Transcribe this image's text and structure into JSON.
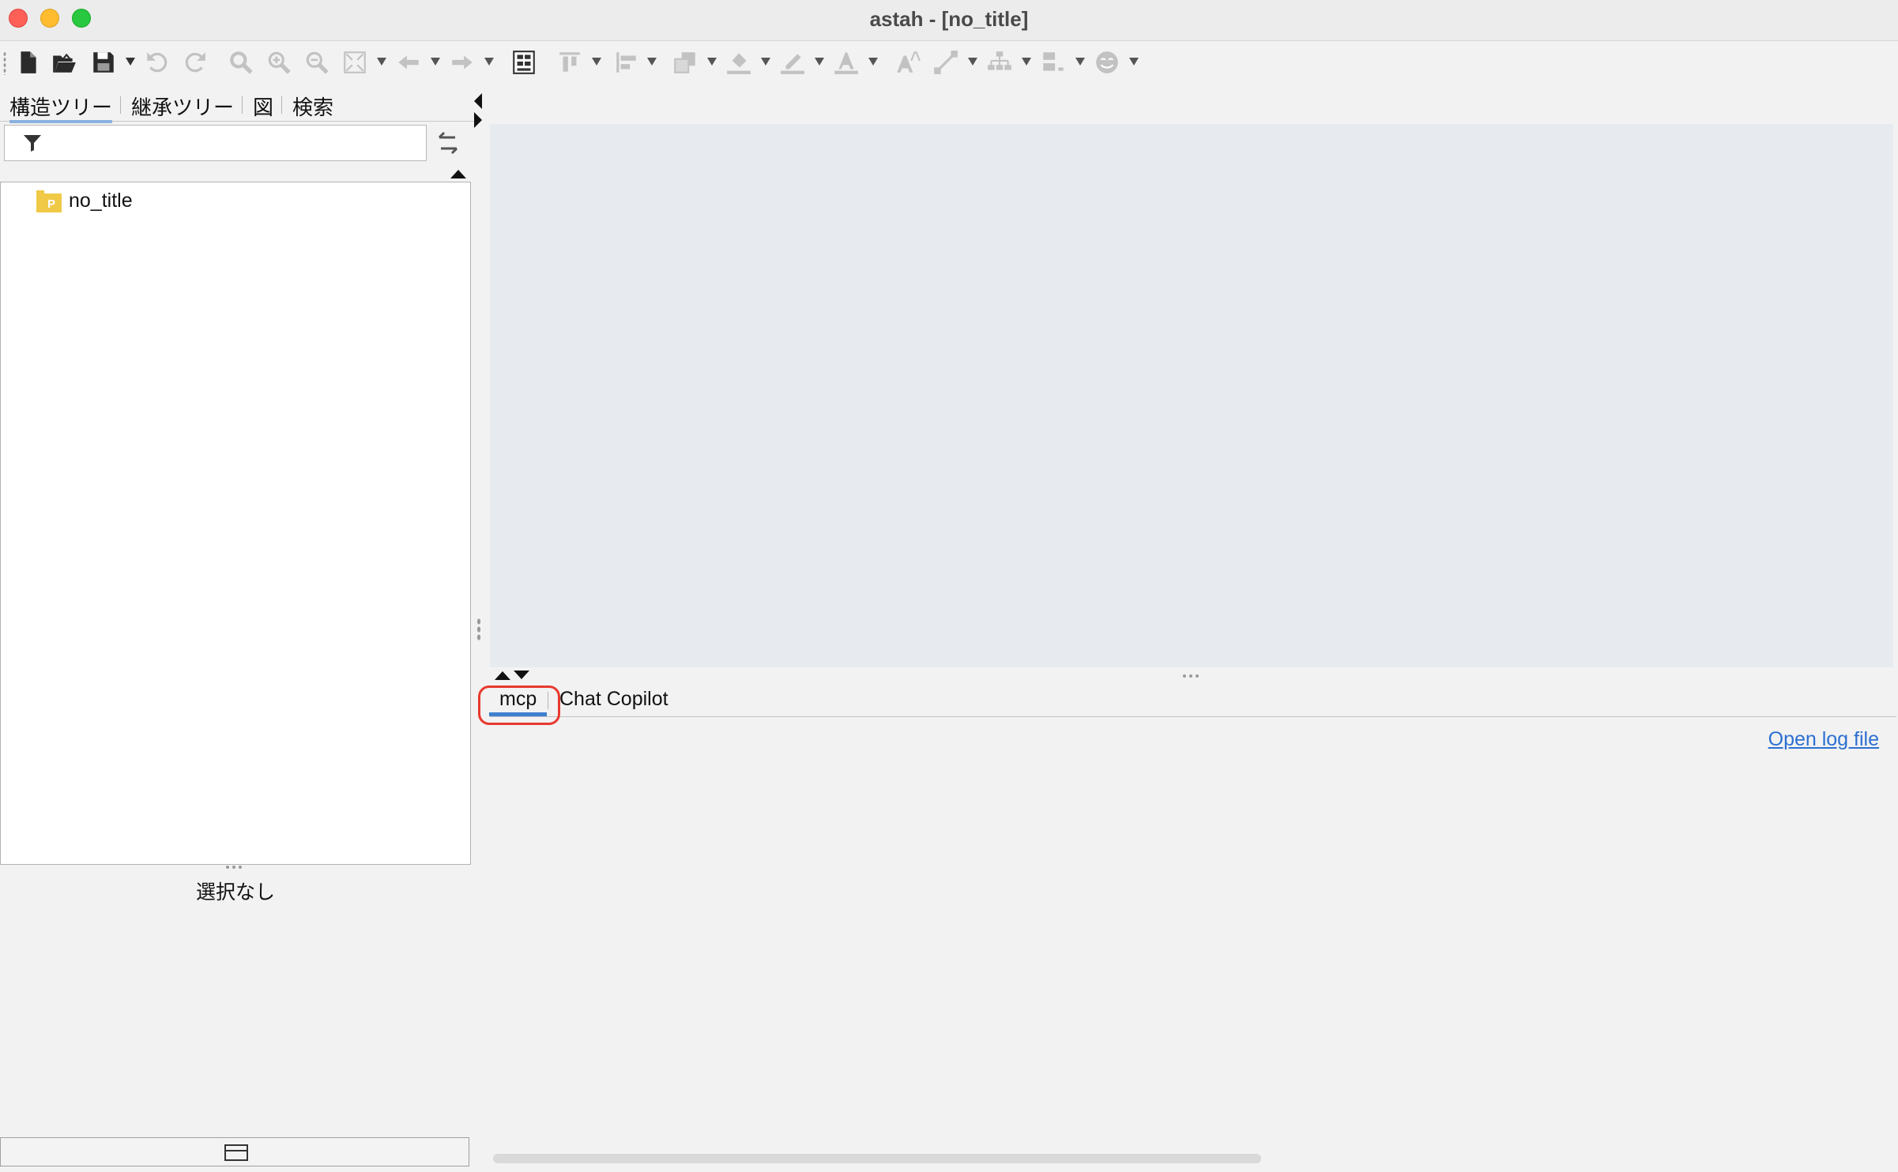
{
  "window": {
    "title": "astah - [no_title]"
  },
  "colors": {
    "close": "#fe5f57",
    "minimize": "#febc2e",
    "maximize": "#28c840",
    "link": "#2c6fd1",
    "active_tab_underline": "#3f7fd0",
    "highlight": "#e8392e",
    "diagram_background": "#e7ebef"
  },
  "toolbar": {
    "buttons": [
      {
        "name": "new-file-icon"
      },
      {
        "name": "open-folder-icon"
      },
      {
        "name": "save-icon"
      },
      {
        "name": "undo-icon"
      },
      {
        "name": "redo-icon"
      },
      {
        "name": "zoom-icon"
      },
      {
        "name": "zoom-in-icon"
      },
      {
        "name": "zoom-out-icon"
      },
      {
        "name": "fit-window-icon"
      },
      {
        "name": "arrow-left-icon"
      },
      {
        "name": "arrow-right-icon"
      },
      {
        "name": "diagram-info-icon"
      },
      {
        "name": "align-top-icon"
      },
      {
        "name": "align-left-icon"
      },
      {
        "name": "layer-icon"
      },
      {
        "name": "fill-color-icon"
      },
      {
        "name": "line-color-icon"
      },
      {
        "name": "font-color-icon"
      },
      {
        "name": "font-style-icon"
      },
      {
        "name": "line-style-icon"
      },
      {
        "name": "tree-layout-icon"
      },
      {
        "name": "size-icon"
      },
      {
        "name": "emoji-icon"
      }
    ]
  },
  "left_panel": {
    "tabs": [
      {
        "label": "構造ツリー",
        "active": true
      },
      {
        "label": "継承ツリー",
        "active": false
      },
      {
        "label": "図",
        "active": false
      },
      {
        "label": "検索",
        "active": false
      }
    ],
    "filter": {
      "value": "",
      "placeholder": ""
    },
    "tree": [
      {
        "label": "no_title",
        "icon": "package-icon",
        "badge": "P"
      }
    ],
    "status": "選択なし"
  },
  "bottom_panel": {
    "tabs": [
      {
        "label": "mcp",
        "active": true
      },
      {
        "label": "Chat Copilot",
        "active": false
      }
    ],
    "link": "Open log file"
  }
}
